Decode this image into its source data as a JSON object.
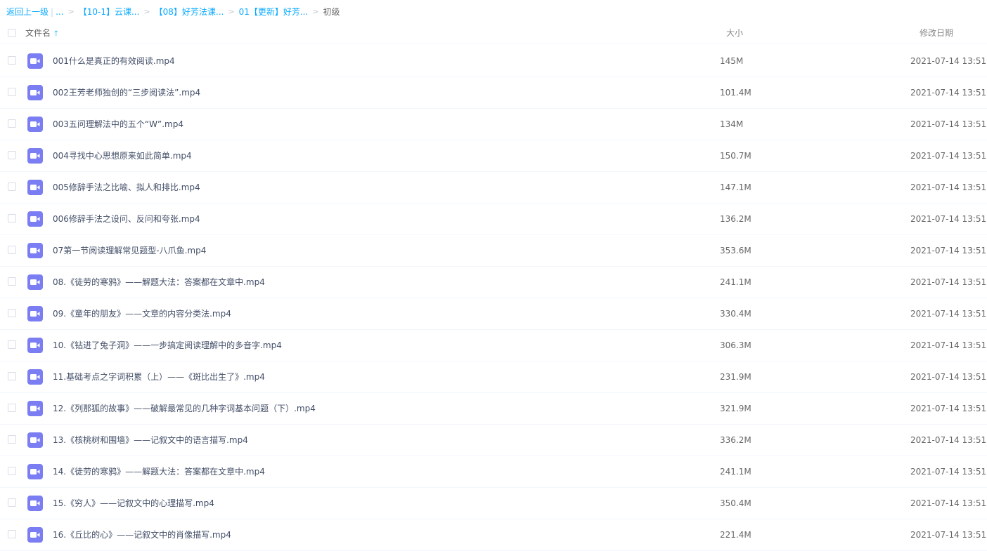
{
  "breadcrumb": {
    "back": "返回上一级",
    "ellipsis": "...",
    "crumbs": [
      "【10-1】云课...",
      "【08】好芳法课...",
      "01【更新】好芳..."
    ],
    "current": "初级"
  },
  "columns": {
    "name": "文件名",
    "size": "大小",
    "date": "修改日期"
  },
  "files": [
    {
      "name": "001什么是真正的有效阅读.mp4",
      "size": "145M",
      "date": "2021-07-14 13:51"
    },
    {
      "name": "002王芳老师独创的“三步阅读法”.mp4",
      "size": "101.4M",
      "date": "2021-07-14 13:51"
    },
    {
      "name": "003五问理解法中的五个“W”.mp4",
      "size": "134M",
      "date": "2021-07-14 13:51"
    },
    {
      "name": "004寻找中心思想原来如此简单.mp4",
      "size": "150.7M",
      "date": "2021-07-14 13:51"
    },
    {
      "name": "005修辞手法之比喻、拟人和排比.mp4",
      "size": "147.1M",
      "date": "2021-07-14 13:51"
    },
    {
      "name": "006修辞手法之设问、反问和夸张.mp4",
      "size": "136.2M",
      "date": "2021-07-14 13:51"
    },
    {
      "name": "07第一节阅读理解常见题型-八爪鱼.mp4",
      "size": "353.6M",
      "date": "2021-07-14 13:51"
    },
    {
      "name": "08.《徒劳的寒鸦》——解题大法：答案都在文章中.mp4",
      "size": "241.1M",
      "date": "2021-07-14 13:51"
    },
    {
      "name": "09.《童年的朋友》——文章的内容分类法.mp4",
      "size": "330.4M",
      "date": "2021-07-14 13:51"
    },
    {
      "name": "10.《钻进了兔子洞》——一步搞定阅读理解中的多音字.mp4",
      "size": "306.3M",
      "date": "2021-07-14 13:51"
    },
    {
      "name": "11.基础考点之字词积累（上）——《斑比出生了》.mp4",
      "size": "231.9M",
      "date": "2021-07-14 13:51"
    },
    {
      "name": "12.《列那狐的故事》——破解最常见的几种字词基本问题（下）.mp4",
      "size": "321.9M",
      "date": "2021-07-14 13:51"
    },
    {
      "name": "13.《核桃树和围墙》——记叙文中的语言描写.mp4",
      "size": "336.2M",
      "date": "2021-07-14 13:51"
    },
    {
      "name": "14.《徒劳的寒鸦》——解题大法：答案都在文章中.mp4",
      "size": "241.1M",
      "date": "2021-07-14 13:51"
    },
    {
      "name": "15.《穷人》——记叙文中的心理描写.mp4",
      "size": "350.4M",
      "date": "2021-07-14 13:51"
    },
    {
      "name": "16.《丘比的心》——记叙文中的肖像描写.mp4",
      "size": "221.4M",
      "date": "2021-07-14 13:51"
    }
  ],
  "icons": {
    "file": "video-file-icon",
    "sort": "sort-ascending-icon"
  },
  "colors": {
    "accent": "#09aaff",
    "video_icon": "#7b7ef2"
  }
}
